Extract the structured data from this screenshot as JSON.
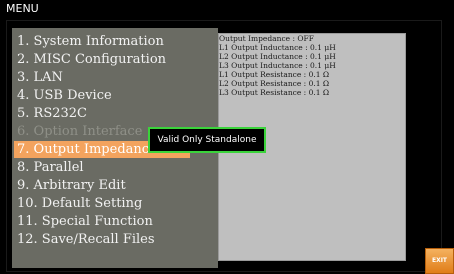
{
  "window": {
    "title": "MENU"
  },
  "menu": {
    "items": [
      {
        "label": "1. System Information",
        "state": "normal"
      },
      {
        "label": "2. MISC Configuration",
        "state": "normal"
      },
      {
        "label": "3. LAN",
        "state": "normal"
      },
      {
        "label": "4. USB Device",
        "state": "normal"
      },
      {
        "label": "5. RS232C",
        "state": "normal"
      },
      {
        "label": "6. Option Interface",
        "state": "disabled"
      },
      {
        "label": "7. Output Impedance",
        "state": "selected"
      },
      {
        "label": "8. Parallel",
        "state": "normal"
      },
      {
        "label": "9. Arbitrary Edit",
        "state": "normal"
      },
      {
        "label": "10. Default Setting",
        "state": "normal"
      },
      {
        "label": "11. Special Function",
        "state": "normal"
      },
      {
        "label": "12. Save/Recall Files",
        "state": "normal"
      }
    ]
  },
  "info": {
    "lines": [
      "Output Impedance : OFF",
      "L1 Output Inductance : 0.1 μH",
      "L2 Output Inductance : 0.1 μH",
      "L3 Output Inductance : 0.1 μH",
      "L1 Output Resistance : 0.1 Ω",
      "L2 Output Resistance : 0.1 Ω",
      "L3 Output Resistance : 0.1 Ω"
    ]
  },
  "popup": {
    "message": "Valid Only Standalone"
  },
  "softkeys": {
    "exit_label": "EXIT"
  },
  "colors": {
    "menu_bg": "#6a6b63",
    "selected_bg": "#f3a35e",
    "info_bg": "#bfbfbf",
    "popup_border": "#3bd33b",
    "exit_button": "#e07d18"
  }
}
